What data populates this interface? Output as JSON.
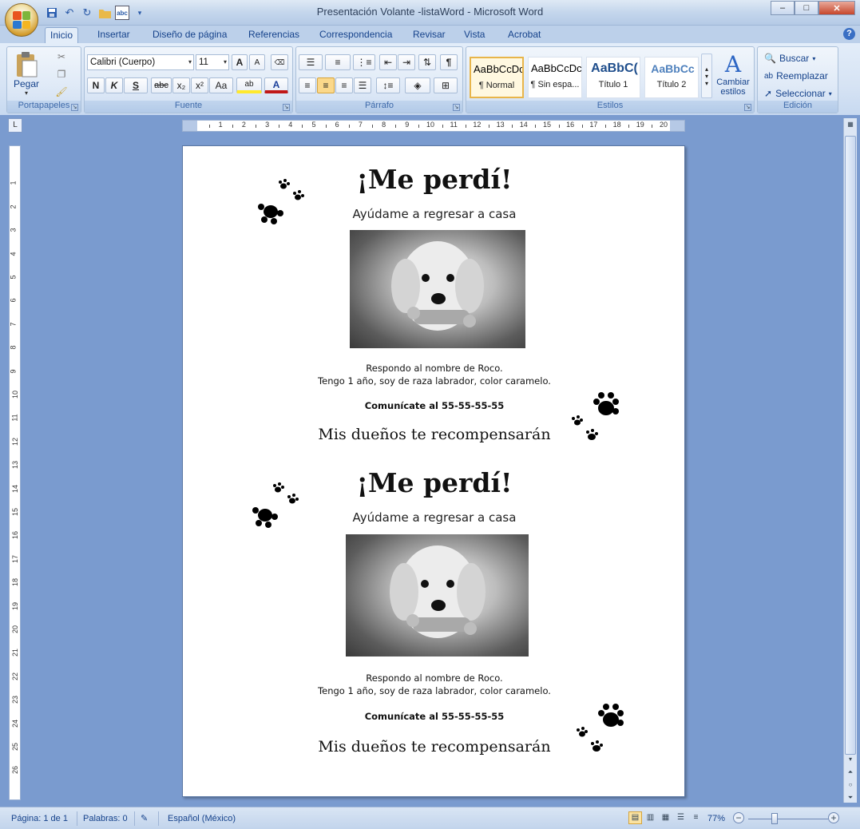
{
  "window": {
    "title": "Presentación Volante -listaWord - Microsoft Word",
    "minimize": "–",
    "maximize": "□",
    "close": "✕"
  },
  "qat": {
    "save_icon": "save-icon",
    "undo_icon": "undo-icon",
    "redo_icon": "redo-icon",
    "open_icon": "folder-icon",
    "spell_icon": "spelling-icon",
    "customize_icon": "chevron-down-icon"
  },
  "tabs": [
    "Inicio",
    "Insertar",
    "Diseño de página",
    "Referencias",
    "Correspondencia",
    "Revisar",
    "Vista",
    "Acrobat"
  ],
  "help": "?",
  "clipboard": {
    "label": "Portapapeles",
    "paste": "Pegar"
  },
  "font": {
    "label": "Fuente",
    "family": "Calibri (Cuerpo)",
    "size": "11",
    "grow": "A",
    "shrink": "A",
    "bold": "N",
    "italic": "K",
    "underline": "S",
    "strike": "abc",
    "subscript": "x₂",
    "superscript": "x²",
    "case": "Aa",
    "highlight": "ab",
    "color": "A"
  },
  "paragraph": {
    "label": "Párrafo",
    "pilcrow": "¶"
  },
  "styles": {
    "label": "Estilos",
    "items": [
      {
        "sample": "AaBbCcDc",
        "name": "¶ Normal"
      },
      {
        "sample": "AaBbCcDc",
        "name": "¶ Sin espa..."
      },
      {
        "sample": "AaBbC(",
        "name": "Título 1"
      },
      {
        "sample": "AaBbCc",
        "name": "Título 2"
      }
    ],
    "change": "Cambiar estilos"
  },
  "editing": {
    "label": "Edición",
    "find": "Buscar",
    "replace": "Reemplazar",
    "select": "Seleccionar"
  },
  "document": {
    "flyers": [
      {
        "title": "¡Me perdí!",
        "subtitle": "Ayúdame a regresar a casa",
        "line1": "Respondo al nombre de Roco.",
        "line2": "Tengo 1 año, soy de raza labrador, color caramelo.",
        "contact": "Comunícate al 55-55-55-55",
        "reward": "Mis dueños te recompensarán"
      },
      {
        "title": "¡Me perdí!",
        "subtitle": "Ayúdame a regresar a casa",
        "line1": "Respondo al nombre de Roco.",
        "line2": "Tengo 1 año, soy de raza labrador, color caramelo.",
        "contact": "Comunícate al 55-55-55-55",
        "reward": "Mis dueños te recompensarán"
      }
    ]
  },
  "status": {
    "page": "Página: 1 de 1",
    "words": "Palabras: 0",
    "language": "Español (México)",
    "zoom": "77%",
    "zoom_level": 0.77
  },
  "ruler": {
    "unit": "cm",
    "h_numbers": [
      "1",
      "2",
      "3",
      "4",
      "5",
      "6",
      "7",
      "8",
      "9",
      "10",
      "11",
      "12",
      "13",
      "14",
      "15",
      "16",
      "17",
      "18",
      "19",
      "20"
    ],
    "v_numbers": [
      "1",
      "2",
      "3",
      "4",
      "5",
      "6",
      "7",
      "8",
      "9",
      "10",
      "11",
      "12",
      "13",
      "14",
      "15",
      "16",
      "17",
      "18",
      "19",
      "20",
      "21",
      "22",
      "23",
      "24",
      "25",
      "26"
    ]
  }
}
